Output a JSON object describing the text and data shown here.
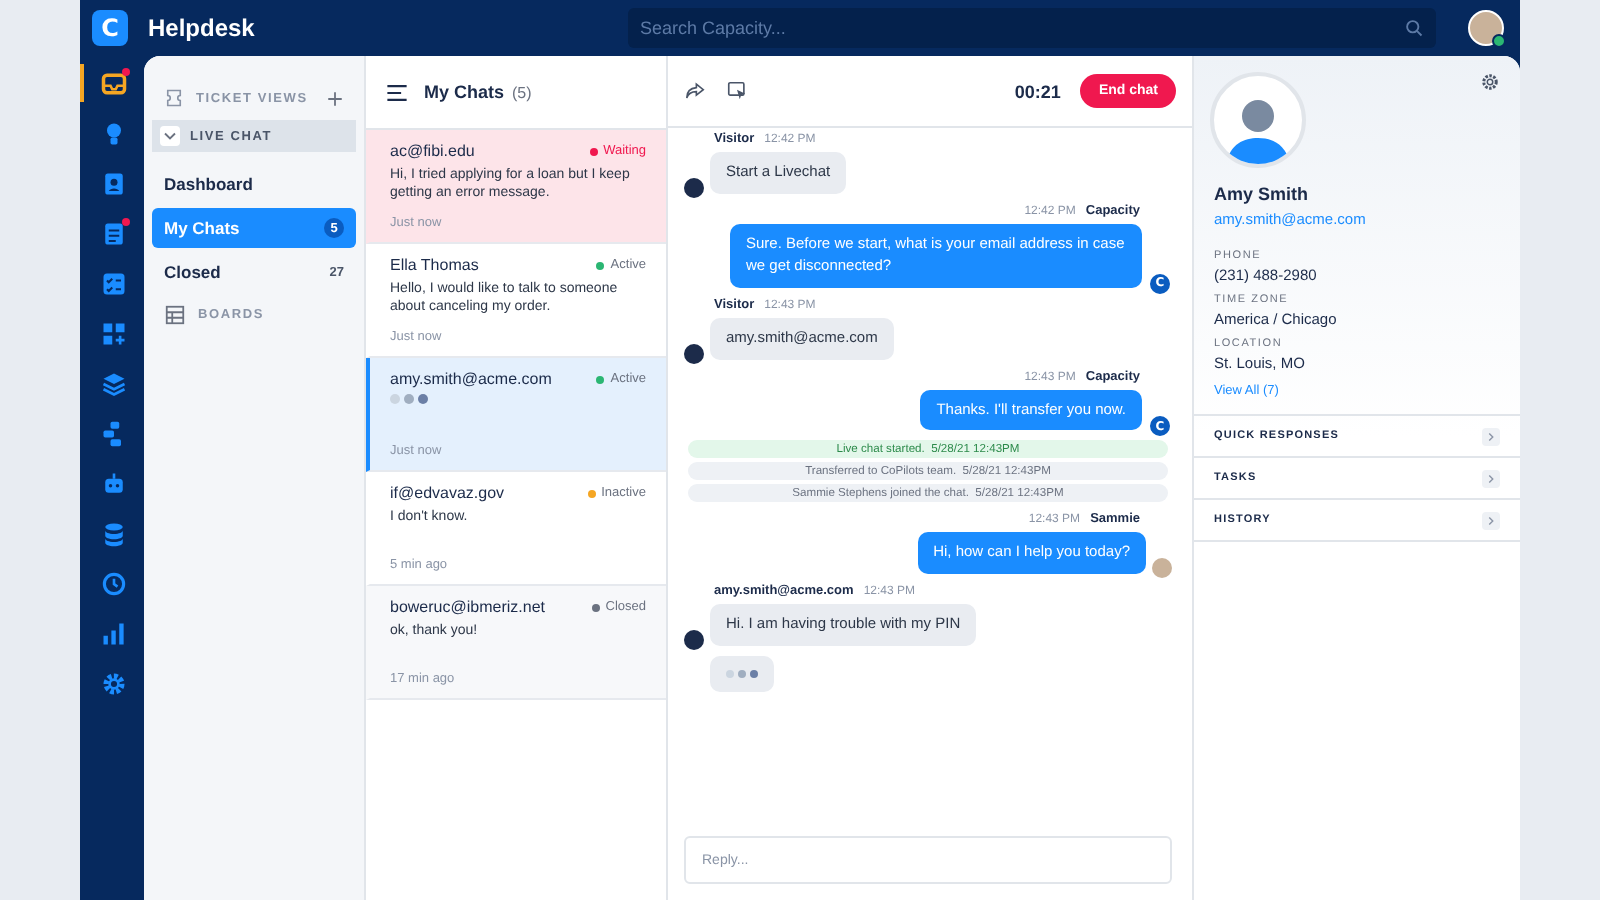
{
  "app": {
    "logo": "C",
    "title": "Helpdesk"
  },
  "search": {
    "placeholder": "Search Capacity..."
  },
  "user": {
    "online": true
  },
  "rail": [
    {
      "selected": true,
      "badge": true
    },
    {
      "selected": false,
      "badge": false
    },
    {
      "selected": false,
      "badge": false
    },
    {
      "selected": false,
      "badge": true
    },
    {
      "selected": false,
      "badge": false
    },
    {
      "selected": false,
      "badge": false
    },
    {
      "selected": false,
      "badge": false
    },
    {
      "selected": false,
      "badge": false
    },
    {
      "selected": false,
      "badge": false
    },
    {
      "selected": false,
      "badge": false
    },
    {
      "selected": false,
      "badge": false
    },
    {
      "selected": false,
      "badge": false
    },
    {
      "selected": false,
      "badge": false
    }
  ],
  "nav": {
    "header": "TICKET VIEWS",
    "group": {
      "label": "LIVE CHAT",
      "expanded": true
    },
    "items": [
      {
        "label": "Dashboard",
        "selected": false
      },
      {
        "label": "My Chats",
        "count": "5",
        "selected": true
      },
      {
        "label": "Closed",
        "count": "27",
        "selected": false
      }
    ],
    "boards": "BOARDS"
  },
  "chats": {
    "title": "My Chats",
    "count": "(5)",
    "items": [
      {
        "kind": "waiting",
        "name": "ac@fibi.edu",
        "status": "Waiting",
        "color": "#f0184f",
        "preview": "Hi, I tried applying for a loan but I keep getting an error message.",
        "time": "Just now",
        "selected": false,
        "typing": false
      },
      {
        "kind": "open",
        "name": "Ella Thomas",
        "status": "Active",
        "color": "#2bb673",
        "preview": "Hello, I would like to talk to someone about canceling my order.",
        "time": "Just now",
        "selected": false,
        "typing": false
      },
      {
        "kind": "open",
        "name": "amy.smith@acme.com",
        "status": "Active",
        "color": "#2bb673",
        "time": "Just now",
        "selected": true,
        "typing": true
      },
      {
        "kind": "open",
        "name": "if@edvavaz.gov",
        "status": "Inactive",
        "color": "#f5a623",
        "preview": "I don't know.",
        "time": "5 min ago",
        "selected": false,
        "typing": false
      },
      {
        "kind": "closed",
        "name": "boweruc@ibmeriz.net",
        "status": "Closed",
        "color": "#6b7280",
        "preview": "ok, thank you!",
        "time": "17 min ago",
        "selected": false,
        "typing": false
      }
    ]
  },
  "conversation": {
    "timer": "00:21",
    "end_button": "End chat",
    "messages": [
      {
        "kind": "visitor",
        "author": "Visitor",
        "time": "12:42 PM",
        "text": "Start a Livechat"
      },
      {
        "kind": "agent",
        "author": "Capacity",
        "time": "12:42 PM",
        "text": "Sure. Before we start, what is your email address in case we get disconnected?",
        "avatar_label": "C"
      },
      {
        "kind": "visitor",
        "author": "Visitor",
        "time": "12:43 PM",
        "text": "amy.smith@acme.com"
      },
      {
        "kind": "agent",
        "author": "Capacity",
        "time": "12:43 PM",
        "text": "Thanks. I'll transfer you now.",
        "avatar_label": "C"
      },
      {
        "kind": "event",
        "text": "Live chat started.",
        "date": "5/28/21 12:43PM",
        "highlight": true
      },
      {
        "kind": "event",
        "text": "Transferred to CoPilots team.",
        "date": "5/28/21 12:43PM",
        "highlight": false
      },
      {
        "kind": "event",
        "text": "Sammie Stephens joined the chat.",
        "date": "5/28/21 12:43PM",
        "highlight": false
      },
      {
        "kind": "agent",
        "author": "Sammie",
        "time": "12:43 PM",
        "text": "Hi, how can I help you today?"
      },
      {
        "kind": "visitor",
        "author": "amy.smith@acme.com",
        "time": "12:43 PM",
        "text": "Hi. I am having trouble with my PIN"
      },
      {
        "kind": "typing"
      }
    ],
    "reply_placeholder": "Reply..."
  },
  "profile": {
    "name": "Amy Smith",
    "email": "amy.smith@acme.com",
    "fields": [
      {
        "label": "PHONE",
        "value": "(231) 488-2980"
      },
      {
        "label": "TIME ZONE",
        "value": "America / Chicago"
      },
      {
        "label": "LOCATION",
        "value": "St. Louis, MO"
      }
    ],
    "view_all": "View All (7)",
    "sections": [
      "QUICK RESPONSES",
      "TASKS",
      "HISTORY"
    ]
  }
}
